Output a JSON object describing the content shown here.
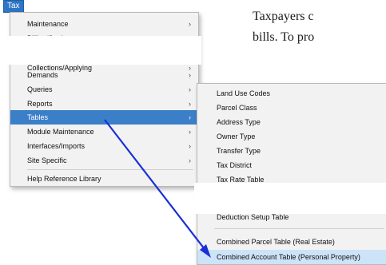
{
  "document": {
    "lines": [
      "Taxpayers c",
      "bills. To pro"
    ]
  },
  "menubar": {
    "tab_label": "Tax"
  },
  "main_menu": {
    "items": [
      {
        "label": "Maintenance",
        "submenu": true
      },
      {
        "label": "Billing/Settlement",
        "submenu": true
      },
      {
        "label": "Collections/Applying",
        "submenu": true
      },
      {
        "label": "Demands",
        "submenu": true
      },
      {
        "label": "Queries",
        "submenu": true
      },
      {
        "label": "Reports",
        "submenu": true
      },
      {
        "label": "Tables",
        "submenu": true,
        "highlighted": true
      },
      {
        "label": "Module Maintenance",
        "submenu": true
      },
      {
        "label": "Interfaces/Imports",
        "submenu": true
      },
      {
        "label": "Site Specific",
        "submenu": true
      },
      {
        "label": "Help Reference Library",
        "submenu": false
      }
    ]
  },
  "tables_submenu": {
    "items": [
      {
        "label": "Land Use Codes"
      },
      {
        "label": "Parcel Class"
      },
      {
        "label": "Address Type"
      },
      {
        "label": "Owner Type"
      },
      {
        "label": "Transfer Type"
      },
      {
        "label": "Tax District"
      },
      {
        "label": "Tax Rate Table"
      },
      {
        "label": "Deduction Setup Table"
      },
      {
        "label": "Combined Parcel Table (Real Estate)"
      },
      {
        "label": "Combined Account Table (Personal Property)",
        "selected": true
      }
    ]
  },
  "colors": {
    "highlight": "#3c7fc9",
    "selected_row": "#cde3f7",
    "annotation_arrow": "#1a2fd6"
  }
}
